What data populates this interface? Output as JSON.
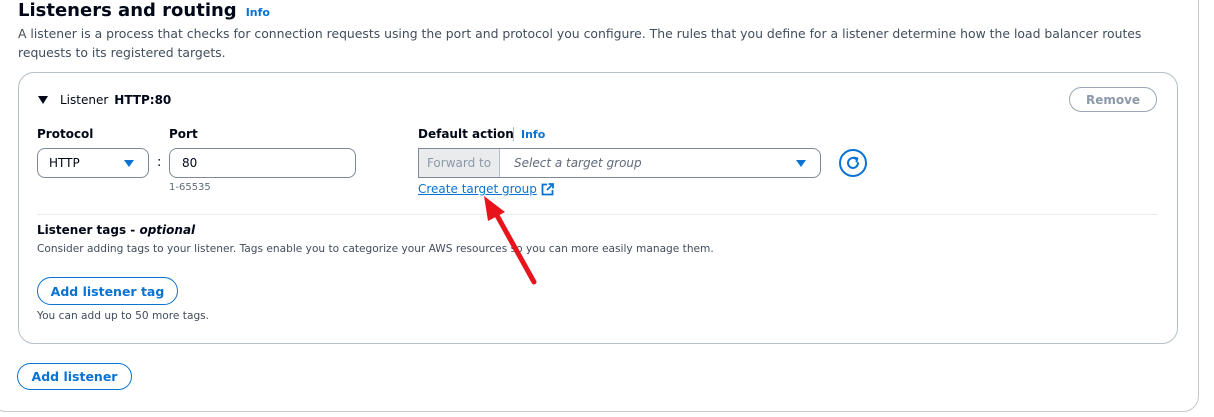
{
  "section": {
    "title": "Listeners and routing",
    "info_label": "Info",
    "description": "A listener is a process that checks for connection requests using the port and protocol you configure. The rules that you define for a listener determine how the load balancer routes requests to its registered targets."
  },
  "listener": {
    "header_label": "Listener",
    "header_value": "HTTP:80",
    "remove_label": "Remove",
    "protocol_label": "Protocol",
    "protocol_value": "HTTP",
    "port_label": "Port",
    "port_value": "80",
    "port_hint": "1-65535",
    "default_action_label": "Default action",
    "default_action_info": "Info",
    "forward_to_label": "Forward to",
    "target_group_placeholder": "Select a target group",
    "create_target_group_label": "Create target group",
    "tags_title": "Listener tags - ",
    "tags_title_optional": "optional",
    "tags_description": "Consider adding tags to your listener. Tags enable you to categorize your AWS resources so you can more easily manage them.",
    "add_tag_label": "Add listener tag",
    "tags_limit": "You can add up to 50 more tags."
  },
  "add_listener_label": "Add listener",
  "icons": {
    "expand": "caret-down-icon",
    "select": "triangle-down-icon",
    "refresh": "refresh-icon",
    "external": "external-link-icon",
    "annotation": "red-arrow-annotation"
  },
  "colors": {
    "link": "#0972d3",
    "annotation": "#e8141c",
    "disabled_bg": "#e9ebed"
  }
}
